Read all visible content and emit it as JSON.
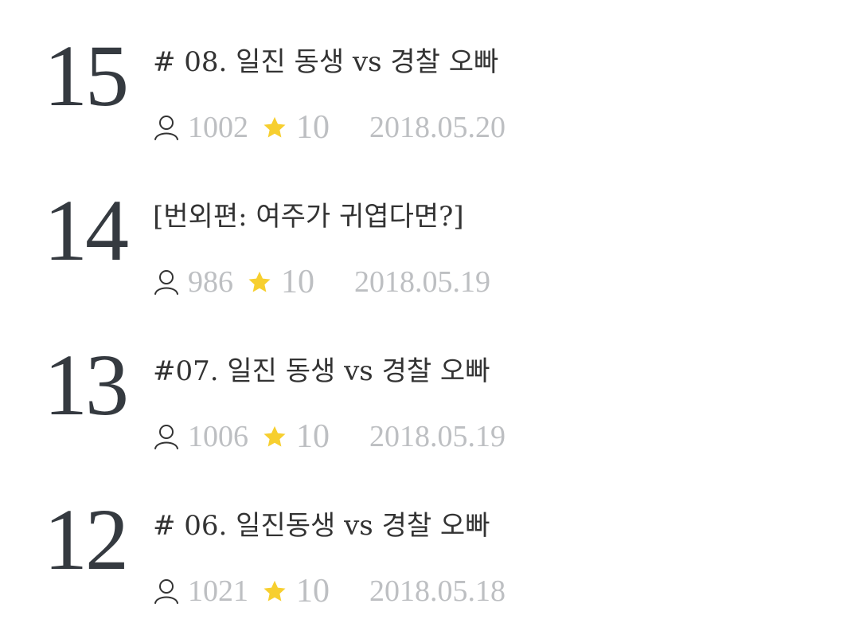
{
  "colors": {
    "number": "#353a40",
    "title": "#333333",
    "meta_text": "#bdbfc2",
    "star": "#f7cf2f",
    "user_icon": "#333333"
  },
  "icons": {
    "views": "user-icon",
    "rating": "star-icon"
  },
  "episodes": [
    {
      "number": "15",
      "title": "# 08. 일진 동생 vs 경찰 오빠",
      "views": "1002",
      "rating": "10",
      "date": "2018.05.20"
    },
    {
      "number": "14",
      "title": "[번외편: 여주가 귀엽다면?]",
      "views": "986",
      "rating": "10",
      "date": "2018.05.19"
    },
    {
      "number": "13",
      "title": "#07. 일진 동생 vs 경찰 오빠",
      "views": "1006",
      "rating": "10",
      "date": "2018.05.19"
    },
    {
      "number": "12",
      "title": "# 06. 일진동생 vs 경찰 오빠",
      "views": "1021",
      "rating": "10",
      "date": "2018.05.18"
    }
  ]
}
